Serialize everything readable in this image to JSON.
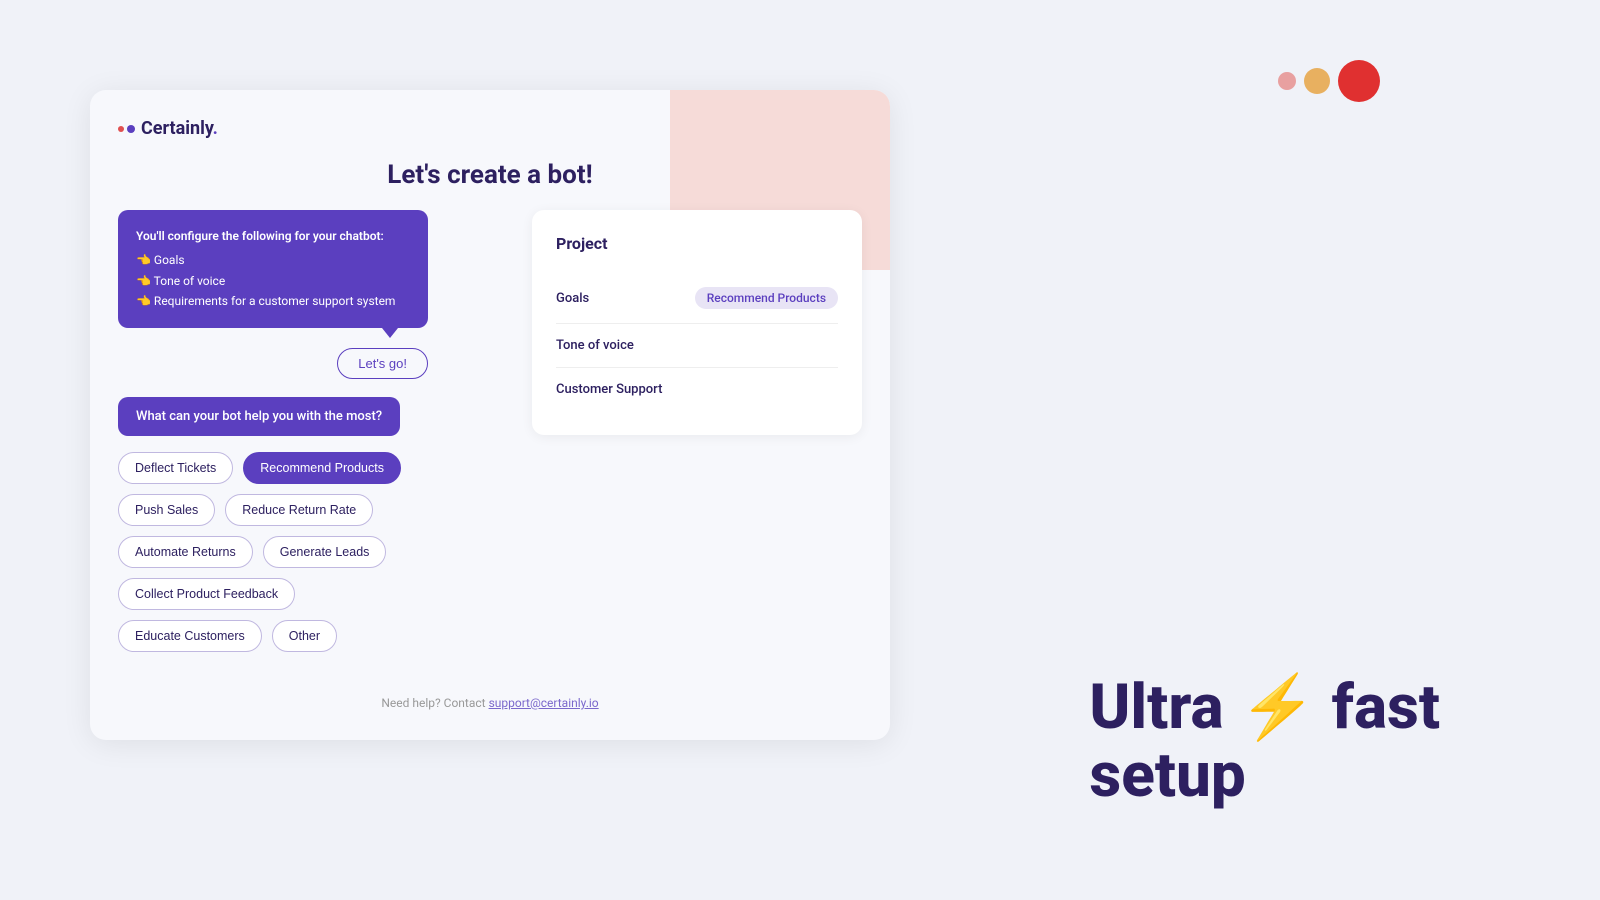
{
  "circles": {
    "sm_color": "#e8a0a0",
    "md_color": "#e8b060",
    "lg_color": "#e03030"
  },
  "logo": {
    "text": "Certainly",
    "dot": "."
  },
  "page": {
    "title": "Let's create a bot!"
  },
  "info_box": {
    "intro": "You'll configure the following for your chatbot:",
    "item1": "👈 Goals",
    "item2": "👈 Tone of voice",
    "item3": "👈 Requirements for a customer support system"
  },
  "lets_go_btn": "Let's go!",
  "question": "What can your bot help you with the most?",
  "options": [
    {
      "label": "Deflect Tickets",
      "selected": false
    },
    {
      "label": "Recommend Products",
      "selected": true
    },
    {
      "label": "Push Sales",
      "selected": false
    },
    {
      "label": "Reduce Return Rate",
      "selected": false
    },
    {
      "label": "Automate Returns",
      "selected": false
    },
    {
      "label": "Generate Leads",
      "selected": false
    },
    {
      "label": "Collect Product Feedback",
      "selected": false
    },
    {
      "label": "Educate Customers",
      "selected": false
    },
    {
      "label": "Other",
      "selected": false
    }
  ],
  "project": {
    "title": "Project",
    "rows": [
      {
        "label": "Goals",
        "value": "Recommend Products"
      },
      {
        "label": "Tone of voice",
        "value": ""
      },
      {
        "label": "Customer Support",
        "value": ""
      }
    ]
  },
  "support": {
    "text": "Need help? Contact ",
    "link_text": "support@certainly.io",
    "link_href": "support@certainly.io"
  },
  "tagline": {
    "prefix": "Ultra ",
    "bolt": "⚡",
    "suffix": " fast",
    "line2": "setup"
  }
}
